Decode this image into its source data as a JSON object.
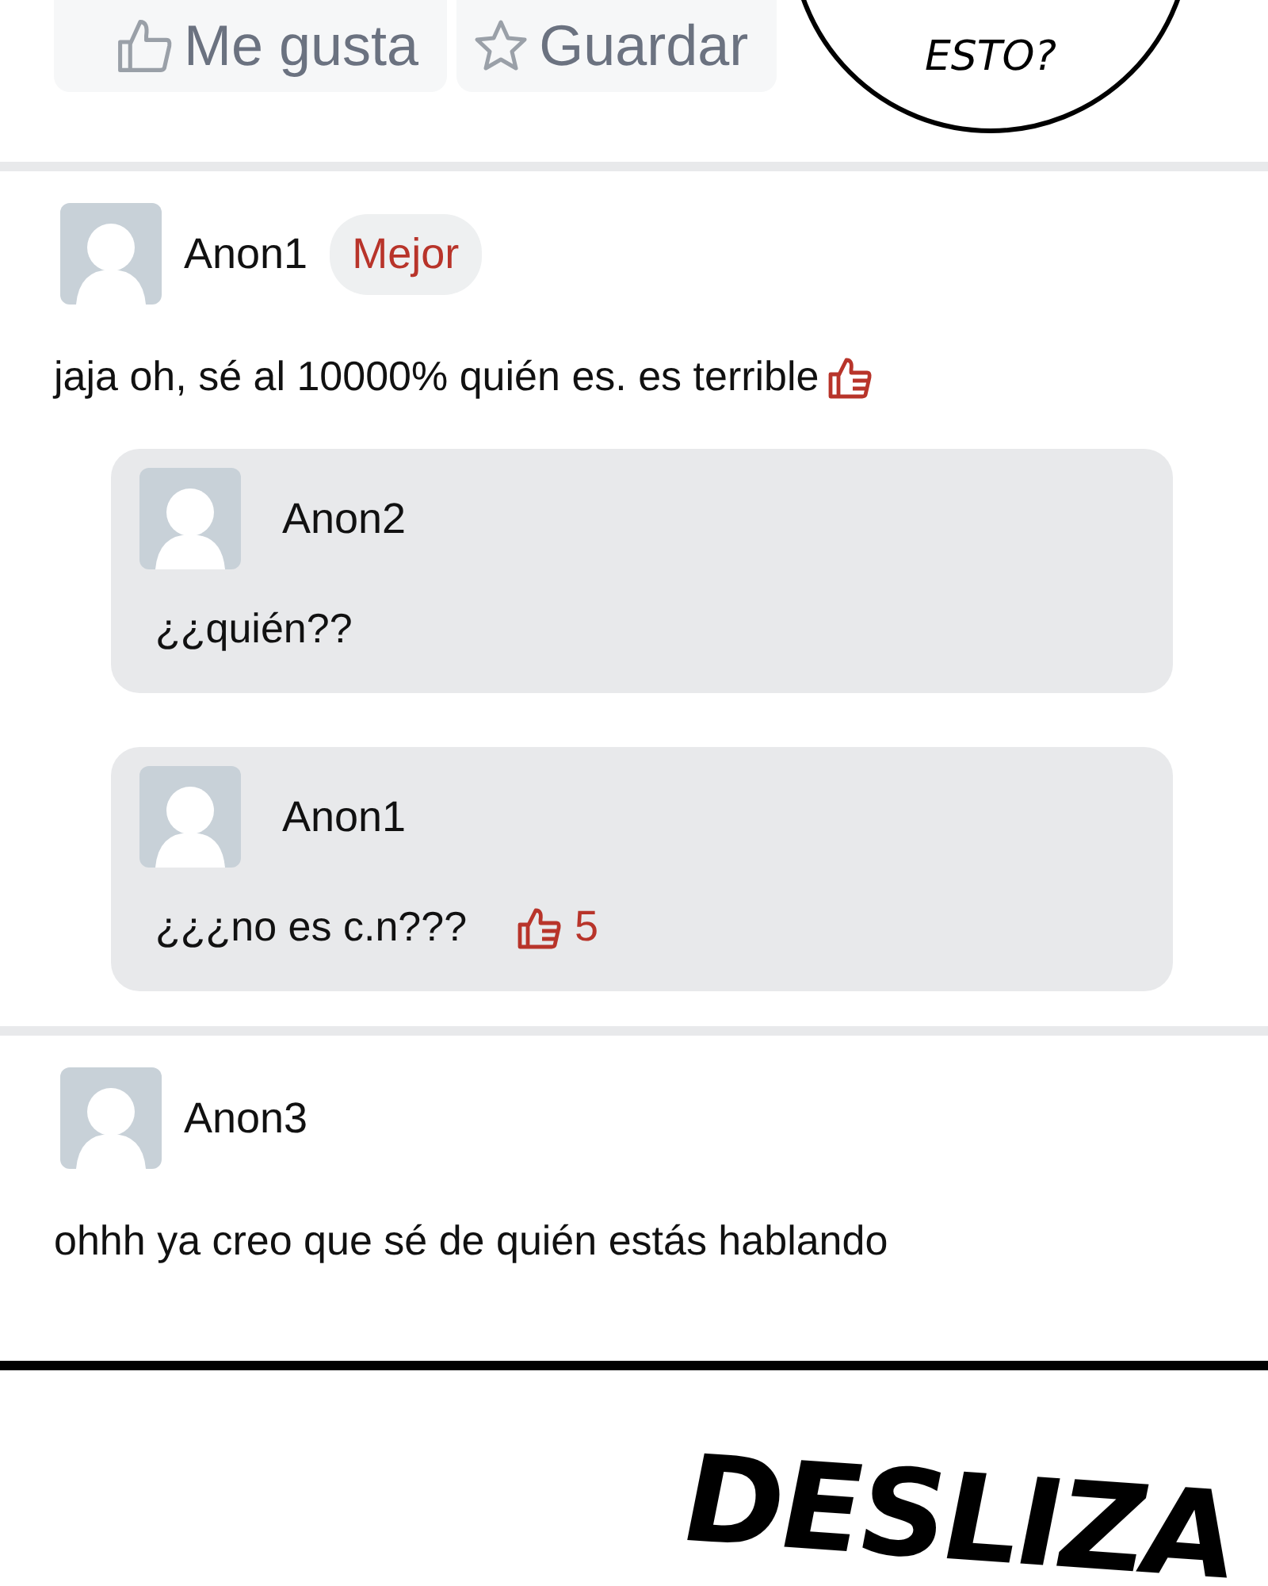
{
  "actions": [
    {
      "kind": "like",
      "label": "Me gusta"
    },
    {
      "kind": "save",
      "label": "Guardar"
    }
  ],
  "speech_bubble": {
    "text": "ESTO?"
  },
  "comments": [
    {
      "author": "Anon1",
      "badge": "Mejor",
      "text": "jaja oh, sé al 10000% quién es. es terrible",
      "liked": true,
      "replies": [
        {
          "author": "Anon2",
          "text": "¿¿quién??"
        },
        {
          "author": "Anon1",
          "text": "¿¿¿no es c.n???",
          "likes": "5"
        }
      ]
    },
    {
      "author": "Anon3",
      "text": "ohhh ya creo que sé de quién estás hablando",
      "liked": false
    }
  ],
  "caption": "DESLIZA"
}
